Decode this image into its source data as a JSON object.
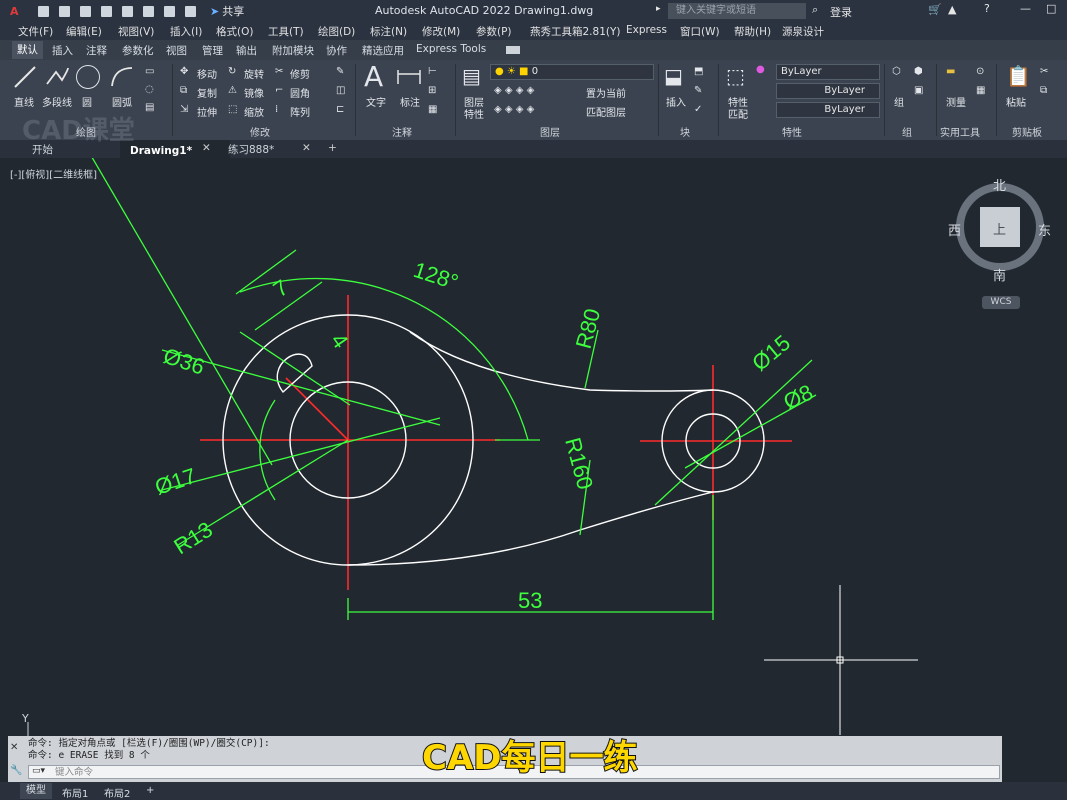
{
  "titlebar": {
    "app_logo": "A",
    "title": "Autodesk AutoCAD 2022    Drawing1.dwg",
    "share": "共享",
    "search_placeholder": "键入关键字或短语",
    "login": "登录"
  },
  "menu": [
    "文件(F)",
    "编辑(E)",
    "视图(V)",
    "插入(I)",
    "格式(O)",
    "工具(T)",
    "绘图(D)",
    "标注(N)",
    "修改(M)",
    "参数(P)",
    "燕秀工具箱2.81(Y)",
    "Express",
    "窗口(W)",
    "帮助(H)",
    "源泉设计"
  ],
  "ribbon_tabs": [
    "默认",
    "插入",
    "注释",
    "参数化",
    "视图",
    "管理",
    "输出",
    "附加模块",
    "协作",
    "精选应用",
    "Express Tools"
  ],
  "ribbon": {
    "draw": {
      "line": "直线",
      "polyline": "多段线",
      "circle": "圆",
      "arc": "圆弧",
      "panel": "绘图"
    },
    "modify": {
      "move": "移动",
      "rotate": "旋转",
      "trim": "修剪",
      "copy": "复制",
      "mirror": "镜像",
      "fillet": "圆角",
      "stretch": "拉伸",
      "scale": "缩放",
      "array": "阵列",
      "panel": "修改"
    },
    "annotation": {
      "text": "文字",
      "dimension": "标注",
      "panel": "注释"
    },
    "layers": {
      "layer_props": "图层",
      "layer_props2": "特性",
      "current_layer": "0",
      "make_current": "置为当前",
      "match_layer": "匹配图层",
      "panel": "图层"
    },
    "block": {
      "insert": "插入",
      "panel": "块"
    },
    "properties": {
      "match": "特性",
      "match2": "匹配",
      "bylayer1": "ByLayer",
      "bylayer2": "ByLayer",
      "bylayer3": "ByLayer",
      "panel": "特性"
    },
    "groups": {
      "group": "组",
      "panel": "组"
    },
    "utilities": {
      "measure": "测量",
      "panel": "实用工具"
    },
    "clipboard": {
      "paste": "粘贴",
      "panel": "剪贴板"
    }
  },
  "doc_tabs": {
    "start": "开始",
    "active": "Drawing1*",
    "other": "练习888*"
  },
  "viewport": {
    "label": "[-][俯视][二维线框]",
    "watermark": "CAD课堂"
  },
  "viewcube": {
    "north": "北",
    "south": "南",
    "east": "东",
    "west": "西",
    "top": "上",
    "wcs": "WCS"
  },
  "dimensions": {
    "angle": "128°",
    "width": "7",
    "offset": "4",
    "d36": "Ø36",
    "d17": "Ø17",
    "r13": "R13",
    "r80": "R80",
    "r160": "R160",
    "d15": "Ø15",
    "d8": "Ø8",
    "dist": "53"
  },
  "ucs": {
    "y": "Y"
  },
  "command": {
    "line1": "命令: 指定对角点或 [栏选(F)/圈围(WP)/圈交(CP)]:",
    "line2": "命令: e ERASE 找到 8 个",
    "input_placeholder": "键入命令"
  },
  "subtitle": "CAD每日一练",
  "layout_tabs": [
    "模型",
    "布局1",
    "布局2"
  ],
  "colors": {
    "dimension": "#3dff3d",
    "centerline": "#ff2b2b",
    "geometry": "#ffffff",
    "background": "#212830"
  }
}
